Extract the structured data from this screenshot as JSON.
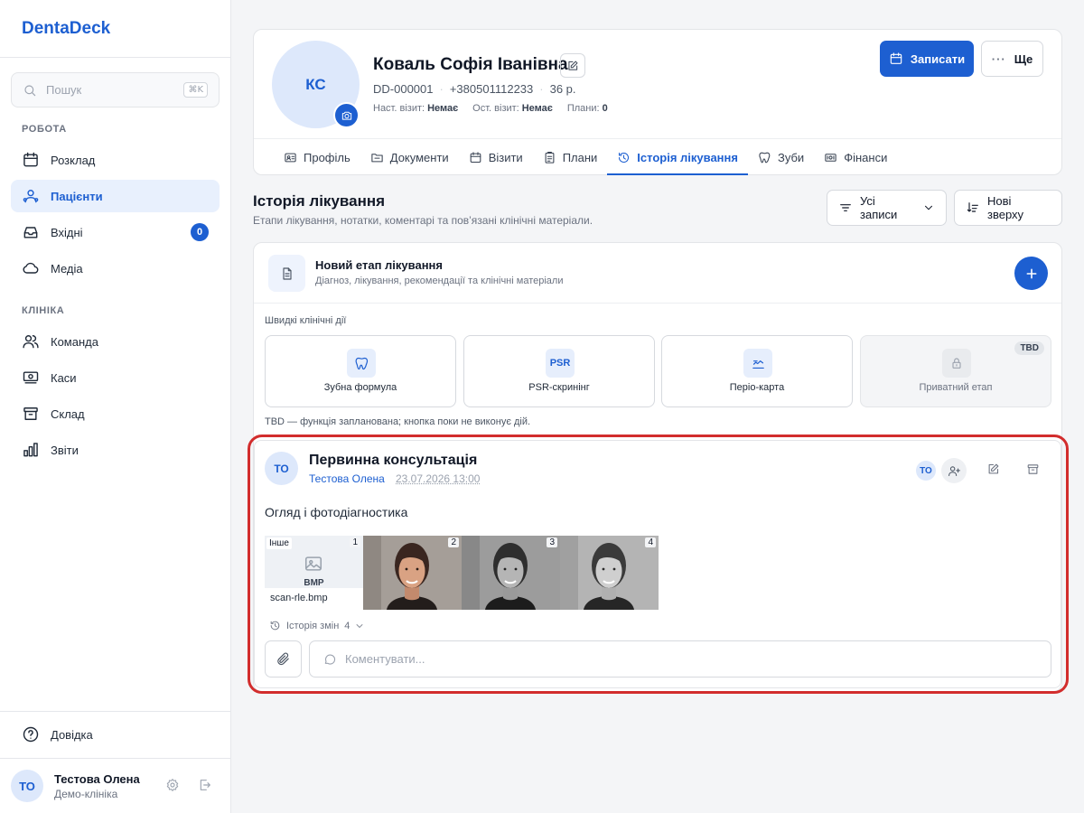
{
  "app": {
    "brand": "DentaDeck"
  },
  "sidebar": {
    "search_label": "Пошук",
    "search_shortcut": "⌘K",
    "work_section": "РОБОТА",
    "work_items": [
      {
        "label": "Розклад",
        "icon": "calendar-icon"
      },
      {
        "label": "Пацієнти",
        "icon": "users-icon",
        "active": true
      },
      {
        "label": "Вхідні",
        "icon": "inbox-icon",
        "badge": "0"
      },
      {
        "label": "Медіа",
        "icon": "cloud-icon"
      }
    ],
    "clinic_section": "КЛІНІКА",
    "clinic_items": [
      {
        "label": "Команда",
        "icon": "team-icon"
      },
      {
        "label": "Каси",
        "icon": "cash-icon"
      },
      {
        "label": "Склад",
        "icon": "archive-icon"
      },
      {
        "label": "Звіти",
        "icon": "bar-chart-icon"
      }
    ],
    "help_label": "Довідка",
    "user": {
      "initials": "ТО",
      "name": "Тестова Олена",
      "clinic": "Демо-клініка"
    }
  },
  "patient": {
    "initials": "КС",
    "name": "Коваль Софія Іванівна",
    "id": "DD-000001",
    "phone": "+380501112233",
    "age": "36 р.",
    "next_visit_label": "Наст. візит:",
    "next_visit_value": "Немає",
    "last_visit_label": "Ост. візит:",
    "last_visit_value": "Немає",
    "plans_label": "Плани:",
    "plans_value": "0",
    "book_button": "Записати",
    "more_button": "Ще"
  },
  "tabs": [
    {
      "label": "Профіль",
      "icon": "profile-card-icon"
    },
    {
      "label": "Документи",
      "icon": "folder-icon"
    },
    {
      "label": "Візити",
      "icon": "calendar-icon"
    },
    {
      "label": "Плани",
      "icon": "clipboard-icon"
    },
    {
      "label": "Історія лікування",
      "icon": "history-icon",
      "active": true
    },
    {
      "label": "Зуби",
      "icon": "tooth-icon"
    },
    {
      "label": "Фінанси",
      "icon": "money-icon"
    }
  ],
  "history": {
    "title": "Історія лікування",
    "subtitle": "Етапи лікування, нотатки, коментарі та пов’язані клінічні матеріали.",
    "filter_label": "Усі записи",
    "sort_label": "Нові зверху"
  },
  "new_stage": {
    "title": "Новий етап лікування",
    "subtitle": "Діагноз, лікування, рекомендації та клінічні матеріали"
  },
  "quick_actions": {
    "label": "Швидкі клінічні дії",
    "items": [
      {
        "label": "Зубна формула",
        "icon": "tooth-icon",
        "disabled": false
      },
      {
        "label": "PSR-скринінг",
        "icon_text": "PSR",
        "disabled": false
      },
      {
        "label": "Періо-карта",
        "icon": "perio-chart-icon",
        "disabled": false
      },
      {
        "label": "Приватний етап",
        "icon": "lock-icon",
        "disabled": true,
        "badge": "TBD"
      }
    ],
    "tbd_note": "TBD — функція запланована; кнопка поки не виконує дій."
  },
  "entry": {
    "initials": "ТО",
    "title": "Первинна консультація",
    "author": "Тестова Олена",
    "date": "23.07.2026 13:00",
    "participant_initials": "ТО",
    "text": "Огляд і фотодіагностика",
    "attachments": [
      {
        "number": "1",
        "type_label": "Інше",
        "format": "BMP",
        "filename": "scan-rle.bmp"
      },
      {
        "number": "2",
        "style": "color"
      },
      {
        "number": "3",
        "style": "gray"
      },
      {
        "number": "4",
        "style": "gray-light"
      }
    ],
    "history_label": "Історія змін",
    "history_count": "4",
    "comment_placeholder": "Коментувати..."
  }
}
